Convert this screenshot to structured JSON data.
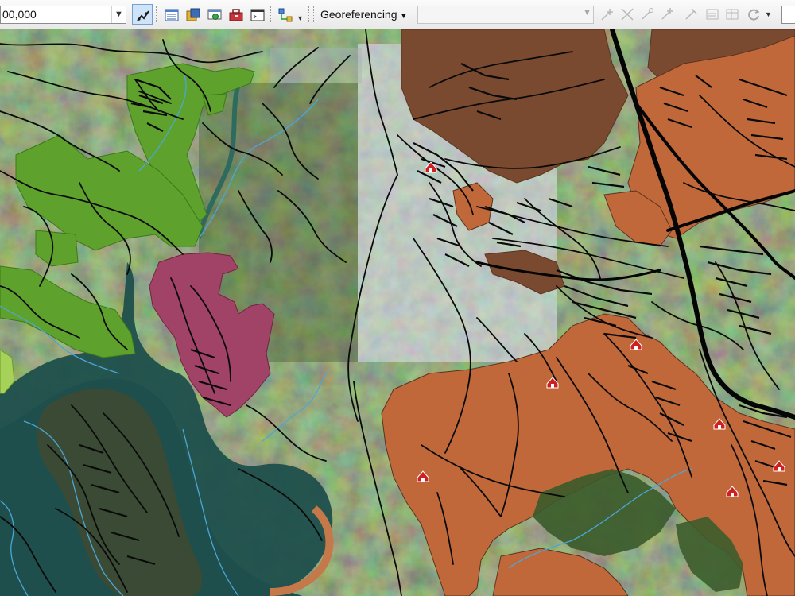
{
  "toolbar": {
    "scale_value": "00,000",
    "georeferencing_label": "Georeferencing",
    "georeferencing_layer_value": ""
  },
  "icons": [
    "edit-tool-icon",
    "attribute-table-icon",
    "catalog-icon",
    "search-window-icon",
    "toolbox-icon",
    "python-window-icon",
    "model-builder-icon",
    "add-control-points-icon",
    "rotate-icon",
    "dropdown-arrow-icon"
  ],
  "map_colors": {
    "water": "#1f4f4c",
    "green_layer": "#5fa12d",
    "light_green_layer": "#a6d25a",
    "magenta_layer": "#a04366",
    "dark_brown_layer": "#7a4a30",
    "orange_layer": "#c0683a",
    "roads": "#0a0a0a",
    "streams": "#4aa7d8",
    "markers": "#cf2020"
  }
}
